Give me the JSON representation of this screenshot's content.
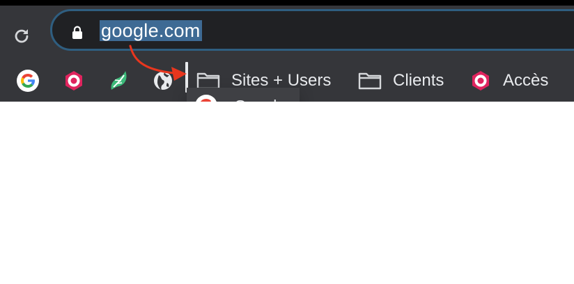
{
  "toolbar": {
    "reload_icon": "reload-icon",
    "lock_icon": "lock-icon"
  },
  "omnibox": {
    "url": "google.com",
    "selected": true,
    "selection_color": "#3e6a94",
    "border_color": "#2f5e80"
  },
  "bookmarks_bar": {
    "items": [
      {
        "label": "",
        "icon": "google-g-icon"
      },
      {
        "label": "",
        "icon": "hexagon-red-icon"
      },
      {
        "label": "",
        "icon": "green-leaf-icon"
      },
      {
        "label": "",
        "icon": "globe-icon"
      },
      {
        "label": "Sites + Users",
        "icon": "folder-icon"
      },
      {
        "label": "Clients",
        "icon": "folder-icon"
      },
      {
        "label": "Accès",
        "icon": "hexagon-red-icon"
      }
    ]
  },
  "drag": {
    "ghost_label": "Google",
    "ghost_icon": "google-g-icon",
    "arrow_color": "#e8361e"
  }
}
